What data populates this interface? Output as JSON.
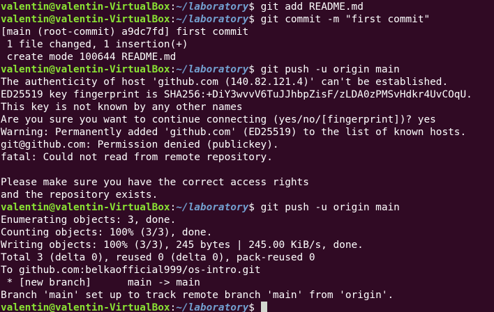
{
  "terminal": {
    "user_host": "valentin@valentin-VirtualBox",
    "path": "~/laboratory",
    "prompt_symbol": "$",
    "lines": [
      {
        "type": "prompt",
        "cmd": " git add README.md"
      },
      {
        "type": "prompt",
        "cmd": " git commit -m \"first commit\""
      },
      {
        "type": "output",
        "text": "[main (root-commit) a9dc7fd] first commit"
      },
      {
        "type": "output",
        "text": " 1 file changed, 1 insertion(+)"
      },
      {
        "type": "output",
        "text": " create mode 100644 README.md"
      },
      {
        "type": "prompt",
        "cmd": " git push -u origin main"
      },
      {
        "type": "output",
        "text": "The authenticity of host 'github.com (140.82.121.4)' can't be established."
      },
      {
        "type": "output",
        "text": "ED25519 key fingerprint is SHA256:+DiY3wvvV6TuJJhbpZisF/zLDA0zPMSvHdkr4UvCOqU."
      },
      {
        "type": "output",
        "text": "This key is not known by any other names"
      },
      {
        "type": "output",
        "text": "Are you sure you want to continue connecting (yes/no/[fingerprint])? yes"
      },
      {
        "type": "output",
        "text": "Warning: Permanently added 'github.com' (ED25519) to the list of known hosts."
      },
      {
        "type": "output",
        "text": "git@github.com: Permission denied (publickey)."
      },
      {
        "type": "output",
        "text": "fatal: Could not read from remote repository."
      },
      {
        "type": "output",
        "text": ""
      },
      {
        "type": "output",
        "text": "Please make sure you have the correct access rights"
      },
      {
        "type": "output",
        "text": "and the repository exists."
      },
      {
        "type": "prompt",
        "cmd": " git push -u origin main"
      },
      {
        "type": "output",
        "text": "Enumerating objects: 3, done."
      },
      {
        "type": "output",
        "text": "Counting objects: 100% (3/3), done."
      },
      {
        "type": "output",
        "text": "Writing objects: 100% (3/3), 245 bytes | 245.00 KiB/s, done."
      },
      {
        "type": "output",
        "text": "Total 3 (delta 0), reused 0 (delta 0), pack-reused 0"
      },
      {
        "type": "output",
        "text": "To github.com:belkaofficial999/os-intro.git"
      },
      {
        "type": "output",
        "text": " * [new branch]      main -> main"
      },
      {
        "type": "output",
        "text": "Branch 'main' set up to track remote branch 'main' from 'origin'."
      },
      {
        "type": "prompt",
        "cmd": " ",
        "cursor": true
      }
    ]
  }
}
